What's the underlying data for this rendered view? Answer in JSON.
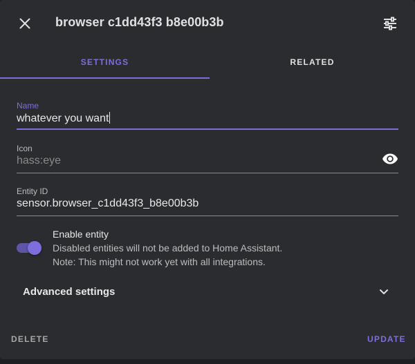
{
  "dialog": {
    "title": "browser c1dd43f3 b8e00b3b",
    "close_icon": "close-icon",
    "settings_icon": "tune-icon"
  },
  "tabs": [
    {
      "label": "SETTINGS",
      "active": true
    },
    {
      "label": "RELATED",
      "active": false
    }
  ],
  "fields": {
    "name": {
      "label": "Name",
      "value": "whatever you want"
    },
    "icon": {
      "label": "Icon",
      "placeholder": "hass:eye",
      "trailing_icon": "eye-icon"
    },
    "entity_id": {
      "label": "Entity ID",
      "value": "sensor.browser_c1dd43f3_b8e00b3b"
    }
  },
  "enable_entity": {
    "title": "Enable entity",
    "description_1": "Disabled entities will not be added to Home Assistant.",
    "description_2": "Note: This might not work yet with all integrations.",
    "enabled": true
  },
  "advanced": {
    "label": "Advanced settings",
    "icon": "chevron-down-icon"
  },
  "footer": {
    "delete_label": "DELETE",
    "update_label": "UPDATE"
  },
  "colors": {
    "accent": "#7c6fdd",
    "dialog_background": "#2b2c30",
    "page_background": "#1e1f22"
  }
}
